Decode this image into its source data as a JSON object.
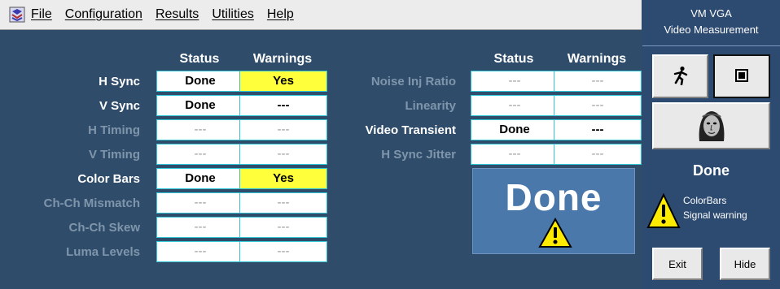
{
  "menu": {
    "items": [
      "File",
      "Configuration",
      "Results",
      "Utilities",
      "Help"
    ]
  },
  "table": {
    "status_header": "Status",
    "warnings_header": "Warnings",
    "left_rows": [
      {
        "label": "H Sync",
        "status": "Done",
        "warnings": "Yes",
        "active": true,
        "warn_highlight": true
      },
      {
        "label": "V Sync",
        "status": "Done",
        "warnings": "---",
        "active": true,
        "warn_highlight": false
      },
      {
        "label": "H Timing",
        "status": "---",
        "warnings": "---",
        "active": false,
        "warn_highlight": false
      },
      {
        "label": "V Timing",
        "status": "---",
        "warnings": "---",
        "active": false,
        "warn_highlight": false
      },
      {
        "label": "Color Bars",
        "status": "Done",
        "warnings": "Yes",
        "active": true,
        "warn_highlight": true
      },
      {
        "label": "Ch-Ch Mismatch",
        "status": "---",
        "warnings": "---",
        "active": false,
        "warn_highlight": false
      },
      {
        "label": "Ch-Ch Skew",
        "status": "---",
        "warnings": "---",
        "active": false,
        "warn_highlight": false
      },
      {
        "label": "Luma Levels",
        "status": "---",
        "warnings": "---",
        "active": false,
        "warn_highlight": false
      }
    ],
    "right_rows": [
      {
        "label": "Noise Inj Ratio",
        "status": "---",
        "warnings": "---",
        "active": false,
        "warn_highlight": false
      },
      {
        "label": "Linearity",
        "status": "---",
        "warnings": "---",
        "active": false,
        "warn_highlight": false
      },
      {
        "label": "Video Transient",
        "status": "Done",
        "warnings": "---",
        "active": true,
        "warn_highlight": false
      },
      {
        "label": "H Sync Jitter",
        "status": "---",
        "warnings": "---",
        "active": false,
        "warn_highlight": false
      }
    ]
  },
  "summary": {
    "big_status": "Done"
  },
  "side": {
    "title_line1": "VM VGA",
    "title_line2": "Video Measurement",
    "status": "Done",
    "message_line1": "ColorBars",
    "message_line2": "Signal warning",
    "exit_label": "Exit",
    "hide_label": "Hide"
  },
  "colors": {
    "background": "#2f4d6b",
    "warning_yellow": "#ffff3c",
    "cell_border": "#32c6d6",
    "done_panel": "#4a78aa"
  },
  "icons": {
    "app": "app-logo-icon",
    "run": "running-man-icon",
    "stop": "stop-square-icon",
    "face": "face-image-icon",
    "warning": "warning-triangle-icon"
  }
}
